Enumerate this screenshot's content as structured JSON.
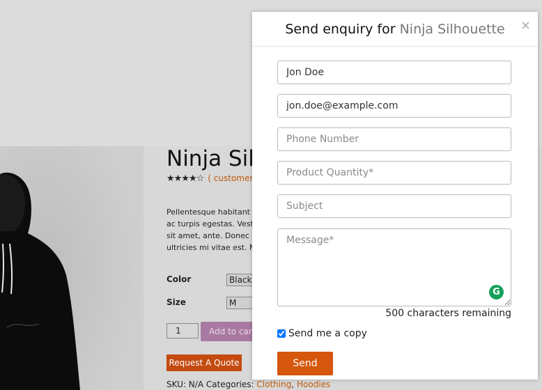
{
  "product": {
    "title": "Ninja Silhouette",
    "stars": "★★★★☆",
    "review_link": "( customer reviews)",
    "description_lines": [
      "Pellentesque habitant morbi tristique senectus et netus",
      "ac turpis egestas. Vestibulum tortor quam, feugiat vitae",
      "sit amet, ante. Donec eu libero sit amet quam egestas",
      "ultricies mi vitae est. Mauris placerat eleifend leo."
    ],
    "color_label": "Color",
    "color_value": "Black",
    "size_label": "Size",
    "size_value": "M",
    "quantity": "1",
    "add_to_cart": "Add to cart",
    "request_quote": "Request A Quote",
    "meta_prefix": "SKU: N/A Categories: ",
    "category_1": "Clothing",
    "category_sep": ", ",
    "category_2": "Hoodies"
  },
  "modal": {
    "title_prefix": "Send enquiry for ",
    "title_product": "Ninja Silhouette",
    "close_label": "×",
    "name_value": "Jon Doe",
    "email_value": "jon.doe@example.com",
    "phone_placeholder": "Phone Number",
    "quantity_placeholder": "Product Quantity*",
    "subject_placeholder": "Subject",
    "message_placeholder": "Message*",
    "chars_remaining": "500 characters remaining",
    "copy_label": "Send me a copy",
    "copy_checked": true,
    "send_label": "Send",
    "grammarly_letter": "G"
  },
  "colors": {
    "accent": "#d5560c",
    "link": "#c0590a",
    "add_to_cart_bg": "#a97aa1",
    "grammarly": "#15a05a"
  }
}
